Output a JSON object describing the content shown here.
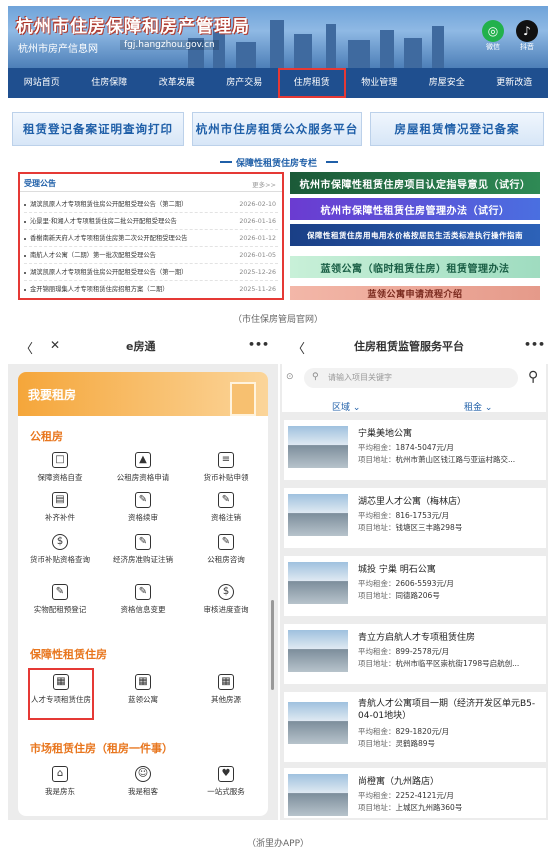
{
  "site": {
    "title": "杭州市住房保障和房产管理局",
    "subtitle": "杭州市房产信息网",
    "url": "fgj.hangzhou.gov.cn",
    "sns": [
      "微信",
      "抖音"
    ],
    "nav": [
      "网站首页",
      "住房保障",
      "改革发展",
      "房产交易",
      "住房租赁",
      "物业管理",
      "房屋安全",
      "更新改造"
    ],
    "promos": [
      "租赁登记备案证明查询打印",
      "杭州市住房租赁公众服务平台",
      "房屋租赁情况登记备案"
    ],
    "special_title": "保障性租赁住房专栏",
    "announcements": {
      "title": "受理公告",
      "more": "更多>>",
      "items": [
        {
          "text": "湖滨凯原人才专项租赁住房公开配租受理公告（第二期）",
          "date": "2026-02-10"
        },
        {
          "text": "沁景里·和湘人才专项租赁住房二批公开配租受理公告",
          "date": "2026-01-16"
        },
        {
          "text": "香榭南新天府人才专项租赁住房第二次公开配租受理公告",
          "date": "2026-01-12"
        },
        {
          "text": "南航人才公寓（二期）第一批次配租受理公告",
          "date": "2026-01-05"
        },
        {
          "text": "湖滨凯原人才专项租赁住房公开配租受理公告（第一期）",
          "date": "2025-12-26"
        },
        {
          "text": "金开锦丽璟集人才专项租赁住房招租方案（二期）",
          "date": "2025-11-26"
        }
      ]
    },
    "right_banners": [
      "杭州市保障性租赁住房项目认定指导意见（试行）",
      "杭州市保障性租赁住房管理办法（试行）",
      "保障性租赁住房用电用水价格按居民生活类标准执行操作指南",
      "蓝领公寓（临时租赁住房）租赁管理办法",
      "蓝领公寓申请流程介绍"
    ],
    "caption": "（市住保房管局官网）"
  },
  "left_app": {
    "back": "〈",
    "close": "✕",
    "title": "e房通",
    "more": "•••",
    "banner": "我要租房",
    "section1": "公租房",
    "section1_items": [
      "保障资格自查",
      "公租房资格申请",
      "货币补贴申领",
      "补齐补件",
      "资格续审",
      "资格注销",
      "货币补贴资格查询",
      "经济房准购证注销",
      "公租房咨询",
      "实物配租预登记",
      "资格信息变更",
      "审核进度查询"
    ],
    "section2": "保障性租赁住房",
    "section2_items": [
      "人才专项租赁住房",
      "蓝领公寓",
      "其他房源"
    ],
    "section3": "市场租赁住房（租房一件事）",
    "section3_items": [
      "我是房东",
      "我是租客",
      "一站式服务"
    ]
  },
  "right_app": {
    "back": "〈",
    "title": "住房租赁监管服务平台",
    "more": "•••",
    "search_placeholder": "请输入项目关键字",
    "filters": [
      "区域 ⌄",
      "租金 ⌄"
    ],
    "price_label": "平均租金：",
    "addr_label": "项目地址：",
    "properties": [
      {
        "name": "宁巢美地公寓",
        "price": "1874-5047元/月",
        "addr": "杭州市萧山区钱江路与亚运村路交..."
      },
      {
        "name": "湖芯里人才公寓（梅林店）",
        "price": "816-1753元/月",
        "addr": "钱塘区三丰路298号"
      },
      {
        "name": "城投 宁巢 明石公寓",
        "price": "2606-5593元/月",
        "addr": "同德路206号"
      },
      {
        "name": "青立方启航人才专项租赁住房",
        "price": "899-2578元/月",
        "addr": "杭州市临平区崇杭街1798号启航创..."
      },
      {
        "name": "青航人才公寓项目一期（经济开发区单元B5-04-01地块）",
        "price": "829-1820元/月",
        "addr": "灵鹤路89号"
      },
      {
        "name": "尚橙寓（九州路店）",
        "price": "2252-4121元/月",
        "addr": "上城区九州路360号"
      }
    ]
  },
  "caption2": "（浙里办APP）"
}
